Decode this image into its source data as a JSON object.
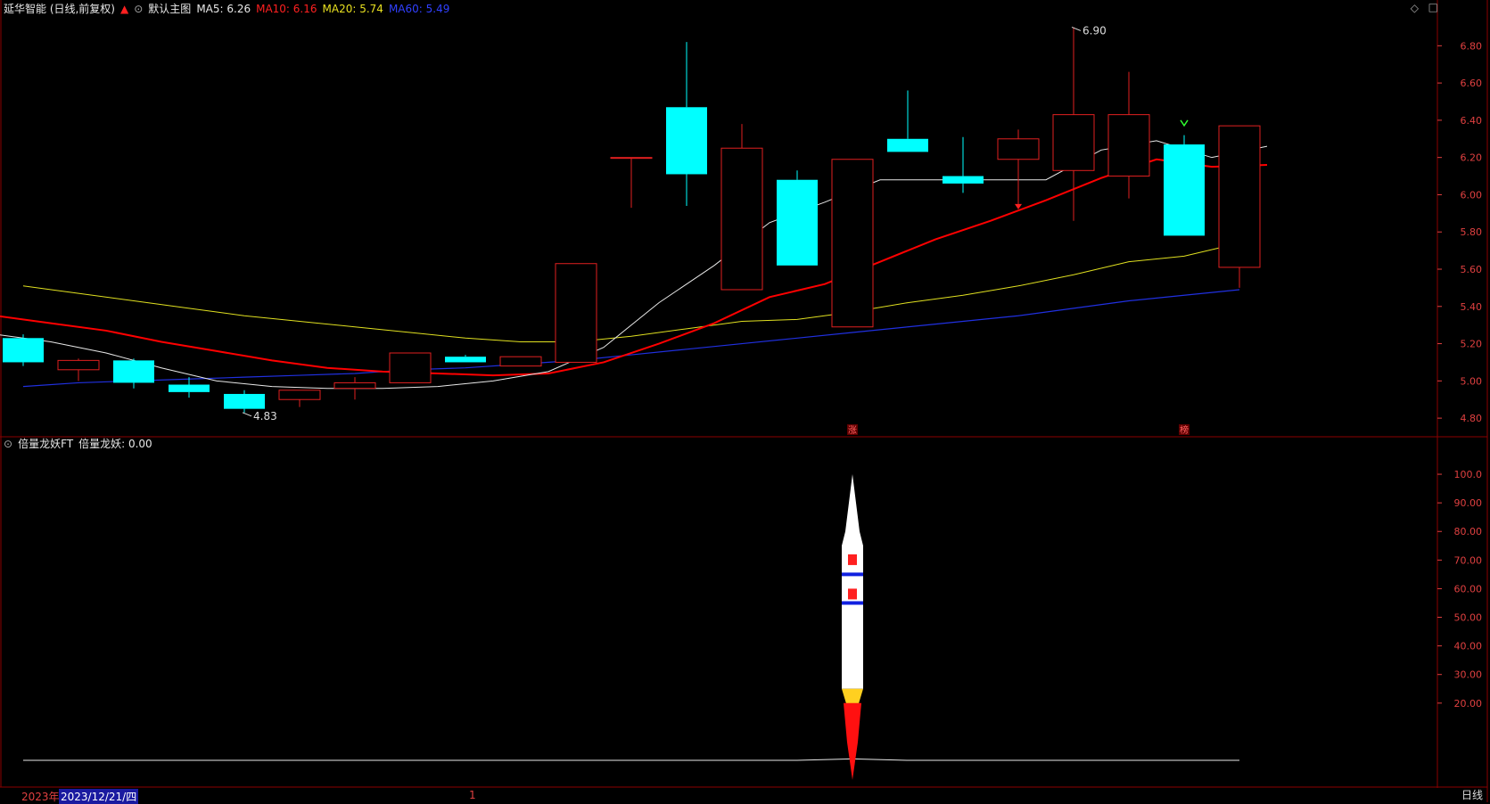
{
  "header": {
    "stock": "延华智能 (日线,前复权)",
    "up_arrow": "up-arrow-icon",
    "menu_icon": "chevron-down-icon",
    "mode": "默认主图",
    "ma5": "MA5: 6.26",
    "ma10": "MA10: 6.16",
    "ma20": "MA20: 5.74",
    "ma60": "MA60: 5.49"
  },
  "indicator_header": {
    "menu_icon": "chevron-down-icon",
    "name": "倍量龙妖FT",
    "value": "倍量龙妖: 0.00"
  },
  "window_controls": {
    "diamond": "diamond-icon",
    "max": "maximize-icon"
  },
  "footer": {
    "year": "2023年",
    "date": "2023/12/21/四",
    "month_marker": "1",
    "period": "日线"
  },
  "colors": {
    "up": "#e02020",
    "down": "#00ffff",
    "ma5": "#e8e8e8",
    "ma10": "#ff0000",
    "ma20": "#e0e020",
    "ma60": "#2030e0",
    "grid": "#8b0000"
  },
  "chart_data": [
    {
      "type": "candlestick",
      "title": "",
      "ylim": [
        4.7,
        6.95
      ],
      "yticks": [
        "6.80",
        "6.60",
        "6.40",
        "6.20",
        "6.00",
        "5.80",
        "5.60",
        "5.40",
        "5.20",
        "5.00",
        "4.80"
      ],
      "candles": [
        {
          "o": 5.23,
          "h": 5.25,
          "l": 5.08,
          "c": 5.1
        },
        {
          "o": 5.06,
          "h": 5.12,
          "l": 5.0,
          "c": 5.11
        },
        {
          "o": 5.11,
          "h": 5.12,
          "l": 4.96,
          "c": 4.99
        },
        {
          "o": 4.98,
          "h": 5.02,
          "l": 4.91,
          "c": 4.94
        },
        {
          "o": 4.93,
          "h": 4.95,
          "l": 4.83,
          "c": 4.85
        },
        {
          "o": 4.9,
          "h": 4.94,
          "l": 4.86,
          "c": 4.95
        },
        {
          "o": 4.96,
          "h": 5.02,
          "l": 4.9,
          "c": 4.99
        },
        {
          "o": 4.99,
          "h": 5.15,
          "l": 4.99,
          "c": 5.15
        },
        {
          "o": 5.13,
          "h": 5.14,
          "l": 5.1,
          "c": 5.1
        },
        {
          "o": 5.08,
          "h": 5.13,
          "l": 5.08,
          "c": 5.13
        },
        {
          "o": 5.1,
          "h": 5.63,
          "l": 5.1,
          "c": 5.63
        },
        {
          "o": 6.2,
          "h": 6.2,
          "l": 5.93,
          "c": 6.2
        },
        {
          "o": 6.47,
          "h": 6.82,
          "l": 5.94,
          "c": 6.11
        },
        {
          "o": 5.49,
          "h": 6.38,
          "l": 5.49,
          "c": 6.25
        },
        {
          "o": 6.08,
          "h": 6.13,
          "l": 5.62,
          "c": 5.62
        },
        {
          "o": 5.29,
          "h": 6.19,
          "l": 5.29,
          "c": 6.19
        },
        {
          "o": 6.3,
          "h": 6.56,
          "l": 6.23,
          "c": 6.23
        },
        {
          "o": 6.1,
          "h": 6.31,
          "l": 6.01,
          "c": 6.06
        },
        {
          "o": 6.19,
          "h": 6.35,
          "l": 5.93,
          "c": 6.3
        },
        {
          "o": 6.13,
          "h": 6.9,
          "l": 5.86,
          "c": 6.43
        },
        {
          "o": 6.1,
          "h": 6.66,
          "l": 5.98,
          "c": 6.43
        },
        {
          "o": 6.27,
          "h": 6.32,
          "l": 5.78,
          "c": 5.78
        },
        {
          "o": 5.61,
          "h": 6.37,
          "l": 5.5,
          "c": 6.37
        }
      ],
      "ma5": [
        5.25,
        5.21,
        5.15,
        5.07,
        5.0,
        4.97,
        4.96,
        4.96,
        4.97,
        5.0,
        5.05,
        5.18,
        5.42,
        5.62,
        5.85,
        5.96,
        6.08,
        6.08,
        6.08,
        6.08,
        6.24,
        6.29,
        6.2,
        6.26
      ],
      "ma10": [
        5.35,
        5.31,
        5.27,
        5.21,
        5.16,
        5.11,
        5.07,
        5.05,
        5.04,
        5.03,
        5.04,
        5.1,
        5.2,
        5.31,
        5.45,
        5.52,
        5.64,
        5.76,
        5.86,
        5.97,
        6.09,
        6.19,
        6.15,
        6.16
      ],
      "ma20": [
        5.51,
        5.47,
        5.43,
        5.39,
        5.35,
        5.32,
        5.29,
        5.26,
        5.23,
        5.21,
        5.21,
        5.24,
        5.28,
        5.32,
        5.33,
        5.37,
        5.42,
        5.46,
        5.51,
        5.57,
        5.64,
        5.67,
        5.74
      ],
      "ma60": [
        4.97,
        4.99,
        5.0,
        5.01,
        5.02,
        5.03,
        5.04,
        5.06,
        5.07,
        5.09,
        5.11,
        5.14,
        5.17,
        5.2,
        5.23,
        5.26,
        5.29,
        5.32,
        5.35,
        5.39,
        5.43,
        5.46,
        5.49
      ],
      "annotations": [
        {
          "label": "6.90",
          "bar": 19,
          "y": 6.9
        },
        {
          "label": "4.83",
          "bar": 4,
          "y": 4.83
        },
        {
          "label": "涨",
          "bar": 15
        },
        {
          "label": "榜",
          "bar": 21
        }
      ]
    },
    {
      "type": "line",
      "title": "倍量龙妖FT",
      "ylim": [
        0,
        105
      ],
      "yticks": [
        "100.0",
        "90.00",
        "80.00",
        "70.00",
        "60.00",
        "50.00",
        "40.00",
        "30.00",
        "20.00"
      ],
      "series": [
        {
          "name": "倍量龙妖",
          "values": [
            0,
            0,
            0,
            0,
            0,
            0,
            0,
            0,
            0,
            0,
            0,
            0,
            0,
            0,
            0,
            0.5,
            0,
            0,
            0,
            0,
            0,
            0,
            0
          ]
        }
      ],
      "rocket": {
        "bar": 15,
        "top": 100.0,
        "blue_bands": [
          65,
          55
        ],
        "flame_top": 25
      }
    }
  ]
}
